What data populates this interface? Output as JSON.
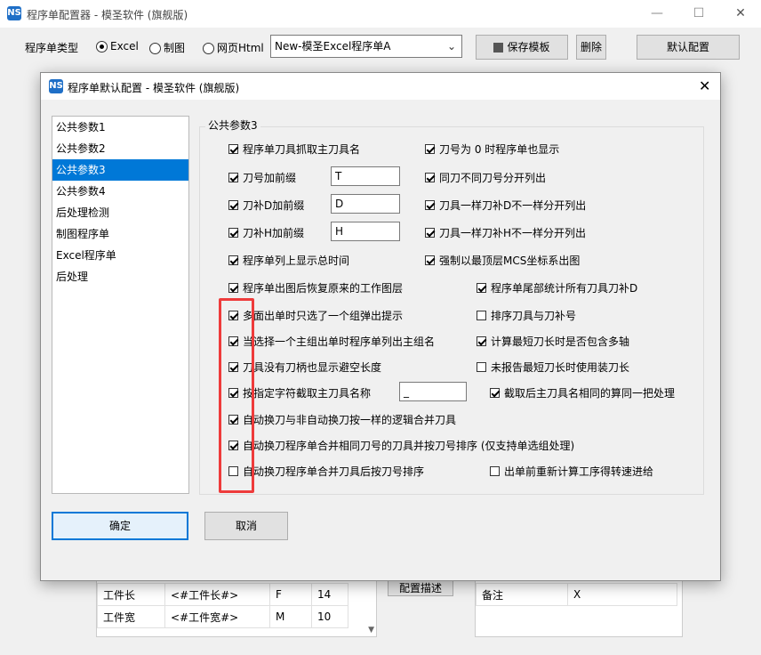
{
  "main_window": {
    "title": "程序单配置器 - 模圣软件 (旗舰版)",
    "type_label": "程序单类型",
    "radios": [
      {
        "label": "Excel",
        "checked": true
      },
      {
        "label": "制图",
        "checked": false
      },
      {
        "label": "网页Html",
        "checked": false
      }
    ],
    "template_select": "New-模圣Excel程序单A",
    "save_template_btn": "保存模板",
    "delete_btn": "删除",
    "default_config_btn": "默认配置",
    "config_desc_btn": "配置描述",
    "left_table": [
      [
        "工件长",
        "<#工件长#>",
        "F",
        "14"
      ],
      [
        "工件宽",
        "<#工件宽#>",
        "M",
        "10"
      ]
    ],
    "right_table": [
      [
        "备注",
        "X"
      ]
    ]
  },
  "dialog": {
    "title": "程序单默认配置 - 模圣软件 (旗舰版)",
    "nav_items": [
      "公共参数1",
      "公共参数2",
      "公共参数3",
      "公共参数4",
      "后处理检测",
      "制图程序单",
      "Excel程序单",
      "后处理"
    ],
    "selected_nav": "公共参数3",
    "group_title": "公共参数3",
    "left_options": [
      {
        "label": "程序单刀具抓取主刀具名",
        "checked": true
      },
      {
        "label": "刀号加前缀",
        "checked": true,
        "value": "T"
      },
      {
        "label": "刀补D加前缀",
        "checked": true,
        "value": "D"
      },
      {
        "label": "刀补H加前缀",
        "checked": true,
        "value": "H"
      },
      {
        "label": "程序单列上显示总时间",
        "checked": true
      },
      {
        "label": "程序单出图后恢复原来的工作图层",
        "checked": true
      },
      {
        "label": "多面出单时只选了一个组弹出提示",
        "checked": true
      },
      {
        "label": "当选择一个主组出单时程序单列出主组名",
        "checked": true
      },
      {
        "label": "刀具没有刀柄也显示避空长度",
        "checked": true
      },
      {
        "label": "按指定字符截取主刀具名称",
        "checked": true,
        "value": "_"
      },
      {
        "label": "自动换刀与非自动换刀按一样的逻辑合并刀具",
        "checked": true
      },
      {
        "label": "自动换刀程序单合并相同刀号的刀具并按刀号排序 (仅支持单选组处理)",
        "checked": true
      },
      {
        "label": "自动换刀程序单合并刀具后按刀号排序",
        "checked": false
      }
    ],
    "right_options": [
      {
        "label": "刀号为 0 时程序单也显示",
        "checked": true
      },
      {
        "label": "同刀不同刀号分开列出",
        "checked": true
      },
      {
        "label": "刀具一样刀补D不一样分开列出",
        "checked": true
      },
      {
        "label": "刀具一样刀补H不一样分开列出",
        "checked": true
      },
      {
        "label": "强制以最顶层MCS坐标系出图",
        "checked": true
      },
      {
        "label": "程序单尾部统计所有刀具刀补D",
        "checked": true
      },
      {
        "label": "排序刀具与刀补号",
        "checked": false
      },
      {
        "label": "计算最短刀长时是否包含多轴",
        "checked": true
      },
      {
        "label": "未报告最短刀长时使用装刀长",
        "checked": false
      },
      {
        "label": "截取后主刀具名相同的算同一把处理",
        "checked": true
      },
      {
        "label": "出单前重新计算工序得转速进给",
        "checked": false
      }
    ],
    "ok_btn": "确定",
    "cancel_btn": "取消"
  },
  "colors": {
    "accent": "#0078d7",
    "highlight": "#ee3b3b"
  }
}
